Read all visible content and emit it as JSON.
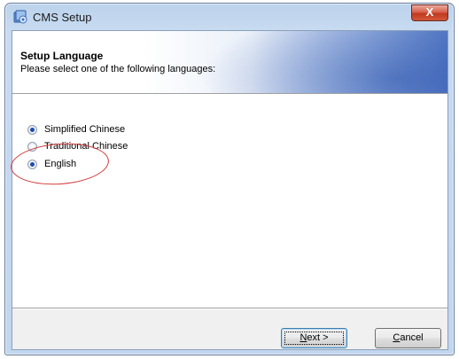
{
  "window": {
    "title": "CMS Setup",
    "close_glyph": "X"
  },
  "header": {
    "title": "Setup Language",
    "subtitle": "Please select one of the following languages:"
  },
  "languages": [
    {
      "label": "Simplified Chinese",
      "checked": true
    },
    {
      "label": "Traditional Chinese",
      "checked": false
    },
    {
      "label": "English",
      "checked": true
    }
  ],
  "buttons": {
    "next_mnemonic": "N",
    "next_rest": "ext >",
    "cancel_mnemonic": "C",
    "cancel_rest": "ancel"
  },
  "icons": {
    "app": "setup-installer-icon",
    "close": "close-icon"
  },
  "colors": {
    "title_bar": "#c7daf0",
    "close_button": "#c0391f",
    "banner_accent": "#5a7ec8",
    "annotation": "#d23a3a"
  }
}
